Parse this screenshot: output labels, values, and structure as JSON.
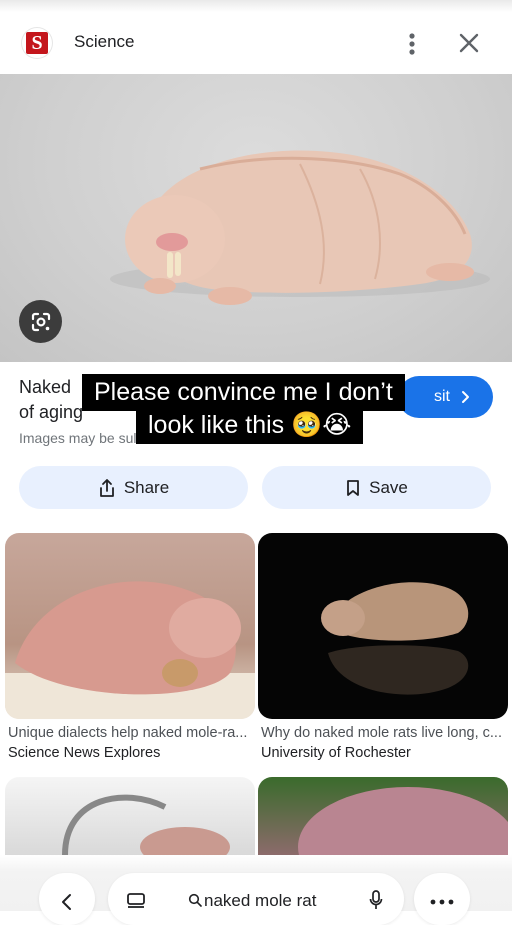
{
  "header": {
    "logo_letter": "S",
    "site_name": "Science"
  },
  "result": {
    "title_line1": "Naked",
    "title_line2": "of aging",
    "disclaimer": "Images may be sul",
    "visit_label": "sit",
    "share_label": "Share",
    "save_label": "Save"
  },
  "caption": {
    "line1": "Please convince me I don’t",
    "line2": "look like this 🥹😭"
  },
  "related": [
    {
      "title": "Unique dialects help naked mole-ra...",
      "source": "Science News Explores"
    },
    {
      "title": "Why do naked mole rats live long, c...",
      "source": "University of Rochester"
    }
  ],
  "bottom_bar": {
    "query": "naked mole rat"
  },
  "icons": {
    "more": "more-vert-icon",
    "close": "close-icon",
    "lens": "google-lens-icon",
    "share": "share-icon",
    "save": "bookmark-icon",
    "back": "chevron-left-icon",
    "tabs": "tabs-icon",
    "search": "search-icon",
    "mic": "mic-icon",
    "overflow": "more-horiz-icon"
  },
  "colors": {
    "accent": "#1a73e8",
    "chip_bg": "#e8f0fe",
    "brand": "#c4161c"
  }
}
